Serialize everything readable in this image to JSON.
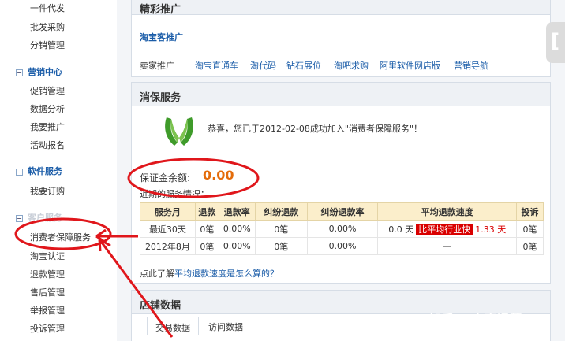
{
  "sidebar": {
    "top_items": [
      "一件代发",
      "批发采购",
      "分销管理"
    ],
    "sections": [
      {
        "title": "营销中心",
        "items": [
          "促销管理",
          "数据分析",
          "我要推广",
          "活动报名"
        ]
      },
      {
        "title": "软件服务",
        "items": [
          "我要订购"
        ]
      },
      {
        "title": "客户服务",
        "items": [
          "消费者保障服务",
          "淘宝认证",
          "退款管理",
          "售后管理",
          "举报管理",
          "投诉管理"
        ]
      }
    ]
  },
  "promo": {
    "title": "精彩推广",
    "taobao_label": "淘宝客推广",
    "seller_label": "卖家推广",
    "links": [
      "淘宝直通车",
      "淘代码",
      "钻石展位",
      "淘吧求购",
      "阿里软件网店版",
      "营销导航"
    ]
  },
  "service": {
    "title": "消保服务",
    "congrats": "恭喜，您已于2012-02-08成功加入\"消费者保障服务\"！",
    "balance_label": "保证金余额:",
    "balance_value": "0.00",
    "recent_label": "近期的服务情况：",
    "columns": [
      "服务月",
      "退款",
      "退款率",
      "纠纷退款",
      "纠纷退款率",
      "平均退款速度",
      "投诉"
    ],
    "rows": [
      {
        "month": "最近30天",
        "refund": "0笔",
        "refund_rate": "0.00%",
        "dispute": "0笔",
        "dispute_rate": "0.00%",
        "speed_prefix": "0.0 天",
        "speed_badge": "比平均行业快",
        "speed_diff": "1.33 天",
        "complaints": "0笔"
      },
      {
        "month": "2012年8月",
        "refund": "0笔",
        "refund_rate": "0.00%",
        "dispute": "0笔",
        "dispute_rate": "0.00%",
        "speed_prefix": "",
        "speed_badge": "",
        "speed_diff": "—",
        "complaints": "0笔"
      }
    ],
    "help_prefix": "点此了解",
    "help_link": "平均退款速度是怎么算的？"
  },
  "store": {
    "title": "店铺数据",
    "tabs": [
      "交易数据",
      "访问数据"
    ]
  },
  "watermark": "知乎 @电商运营",
  "colors": {
    "link": "#1a5ca8",
    "accent": "#e46c0a",
    "annotation": "#e0161b",
    "badge": "#d90000"
  }
}
